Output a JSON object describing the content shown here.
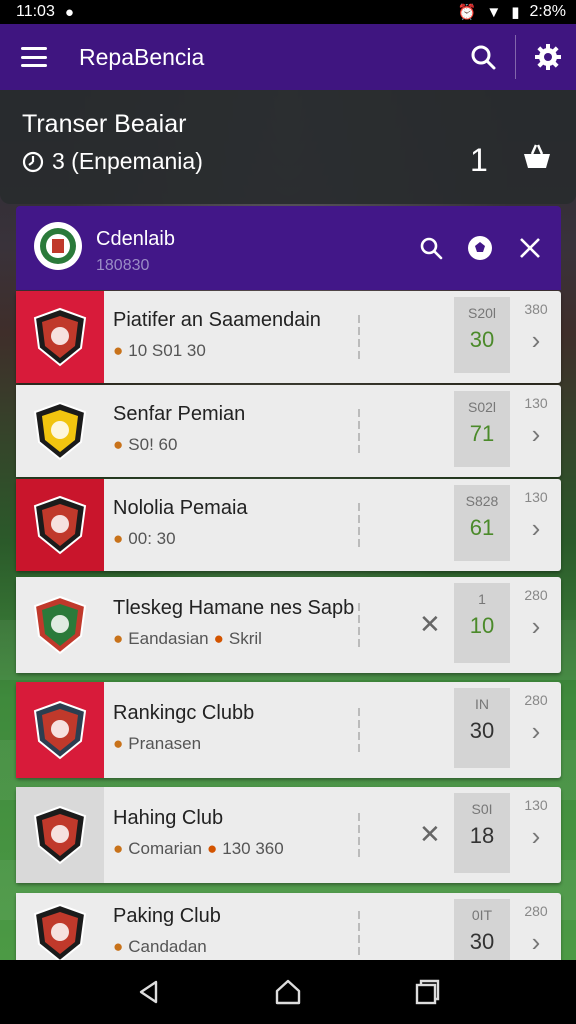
{
  "status_bar": {
    "time": "11:03",
    "battery": "2:8%"
  },
  "app_bar": {
    "title": "RepaBencia"
  },
  "transfer": {
    "title": "Transer Beaiar",
    "subtitle": "3 (Enpemania)",
    "count": "1"
  },
  "club": {
    "name": "Cdenlaib",
    "code": "180830"
  },
  "rows": [
    {
      "name": "Piatifer an Saamendain",
      "sub": "10 S01 30",
      "score_top": "S20l",
      "score": "30",
      "score_color": "#4b8a2a",
      "right_num": "380",
      "badge_bg": "#d81b3a"
    },
    {
      "name": "Senfar Pemian",
      "sub": "S0! 60",
      "score_top": "S02l",
      "score": "71",
      "score_color": "#4b8a2a",
      "right_num": "130",
      "badge_bg": "#ececec"
    },
    {
      "name": "Nololia Pemaia",
      "sub": "00: 30",
      "score_top": "S828",
      "score": "61",
      "score_color": "#4b8a2a",
      "right_num": "130",
      "badge_bg": "#c9152c"
    },
    {
      "name": "Tleskeg Hamane nes Sapb",
      "sub": "Eandasian",
      "sub_extra": "Skril",
      "score_top": "1",
      "score": "10",
      "score_color": "#4b8a2a",
      "right_num": "280",
      "badge_bg": "#ececec",
      "has_x": true
    },
    {
      "name": "Rankingc Clubb",
      "sub": "Pranasen",
      "score_top": "IN",
      "score": "30",
      "score_color": "#333333",
      "right_num": "280",
      "badge_bg": "#d81b3a"
    },
    {
      "name": "Hahing Club",
      "sub": "Comarian",
      "sub_extra": "130 360",
      "score_top": "S0I",
      "score": "18",
      "score_color": "#333333",
      "right_num": "130",
      "badge_bg": "#d9d9d9",
      "has_x": true
    },
    {
      "name": "Paking Club",
      "sub": "Candadan",
      "score_top": "0IT",
      "score": "30",
      "score_color": "#333333",
      "right_num": "280",
      "badge_bg": "#ececec"
    }
  ],
  "colors": {
    "app_bar": "#3f1580",
    "club_header": "#421788",
    "row_bg": "#ececec"
  },
  "icons": [
    "menu-icon",
    "search-icon",
    "settings-icon",
    "clock-icon",
    "basket-icon",
    "close-icon",
    "chevron-right-icon",
    "back-icon",
    "home-icon",
    "recents-icon"
  ]
}
